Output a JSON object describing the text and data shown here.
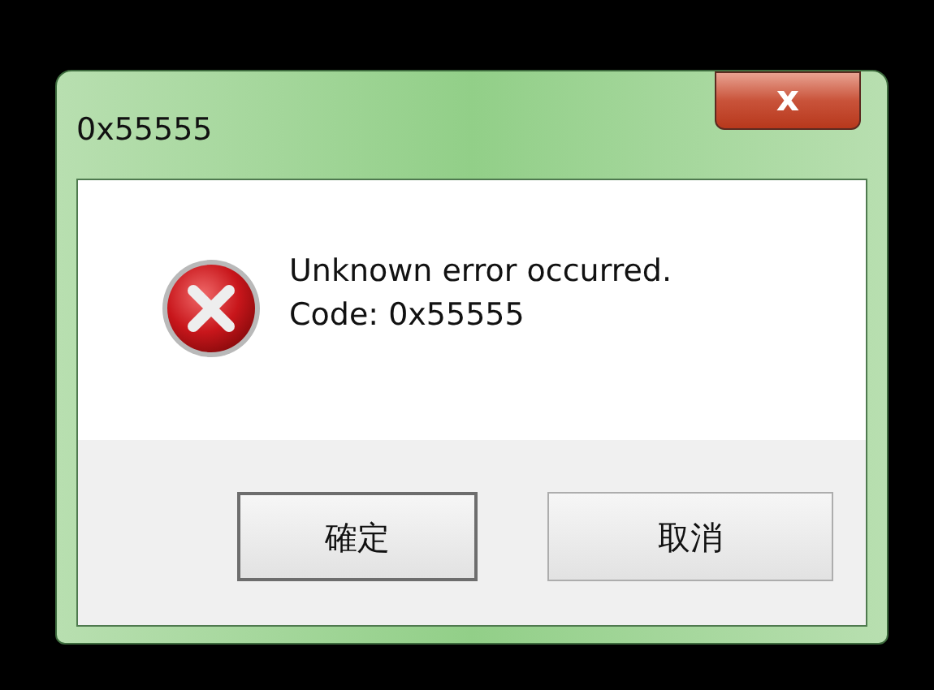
{
  "window": {
    "title": "0x55555",
    "close_button": {
      "label": "x"
    }
  },
  "message": {
    "kind": "error",
    "lines": [
      "Unknown error occurred.",
      "Code: 0x55555"
    ]
  },
  "buttons": [
    {
      "label": "確定",
      "default": true
    },
    {
      "label": "取消",
      "default": false
    }
  ]
}
